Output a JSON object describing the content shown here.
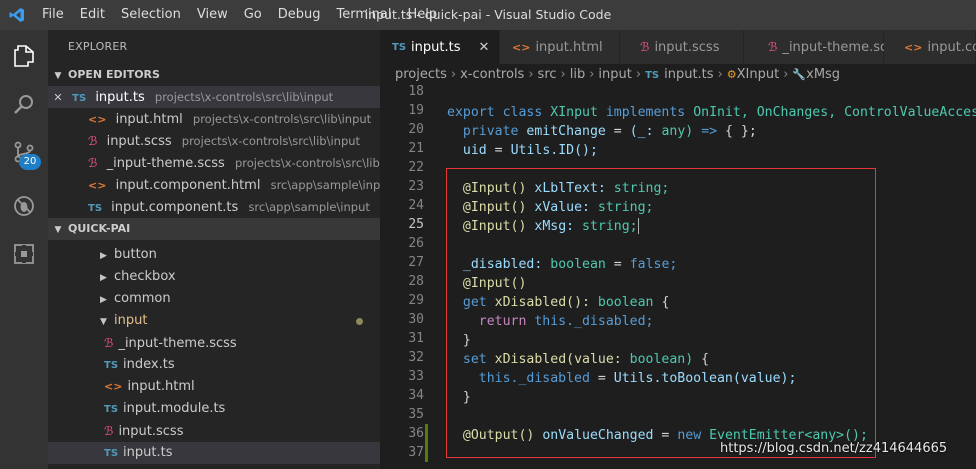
{
  "menu": [
    "File",
    "Edit",
    "Selection",
    "View",
    "Go",
    "Debug",
    "Terminal",
    "Help"
  ],
  "window_title": "input.ts - quick-pai - Visual Studio Code",
  "scm_badge": "20",
  "sidebar": {
    "title": "EXPLORER",
    "open_editors": {
      "header": "OPEN EDITORS",
      "items": [
        {
          "type": "TS",
          "name": "input.ts",
          "path": "projects\\x-controls\\src\\lib\\input",
          "close": "✕"
        },
        {
          "type": "html",
          "name": "input.html",
          "path": "projects\\x-controls\\src\\lib\\input"
        },
        {
          "type": "scss",
          "name": "input.scss",
          "path": "projects\\x-controls\\src\\lib\\input"
        },
        {
          "type": "scss",
          "name": "_input-theme.scss",
          "path": "projects\\x-controls\\src\\lib\\input"
        },
        {
          "type": "html",
          "name": "input.component.html",
          "path": "src\\app\\sample\\input"
        },
        {
          "type": "TS",
          "name": "input.component.ts",
          "path": "src\\app\\sample\\input"
        }
      ]
    },
    "project": {
      "header": "QUICK-PAI",
      "folders": [
        "button",
        "checkbox",
        "common",
        "input"
      ],
      "files": [
        {
          "type": "scss",
          "name": "_input-theme.scss"
        },
        {
          "type": "TS",
          "name": "index.ts"
        },
        {
          "type": "html",
          "name": "input.html"
        },
        {
          "type": "TS",
          "name": "input.module.ts"
        },
        {
          "type": "scss",
          "name": "input.scss"
        },
        {
          "type": "TS",
          "name": "input.ts"
        }
      ]
    }
  },
  "tabs": [
    {
      "type": "TS",
      "label": "input.ts",
      "active": true,
      "close": "✕"
    },
    {
      "type": "html",
      "label": "input.html"
    },
    {
      "type": "scss",
      "label": "input.scss"
    },
    {
      "type": "scss",
      "label": "_input-theme.scss"
    },
    {
      "type": "html",
      "label": "input.com"
    }
  ],
  "breadcrumb": [
    "projects",
    "x-controls",
    "src",
    "lib",
    "input",
    "input.ts",
    "XInput",
    "xMsg"
  ],
  "breadcrumb_ts": "TS",
  "line_numbers": [
    "18",
    "19",
    "20",
    "21",
    "22",
    "23",
    "24",
    "25",
    "26",
    "27",
    "28",
    "29",
    "30",
    "31",
    "32",
    "33",
    "34",
    "35",
    "36",
    "37"
  ],
  "code": {
    "l19": [
      "export",
      "class",
      "XInput",
      "implements",
      "OnInit,",
      "OnChanges,",
      "ControlValueAccessor"
    ],
    "l20": [
      "private",
      "emitChange",
      "=",
      "(_:",
      "any)",
      "=>",
      "{ };"
    ],
    "l21": [
      "uid",
      "=",
      "Utils.ID();"
    ],
    "l23": [
      "@Input()",
      "xLblText:",
      "string;"
    ],
    "l24": [
      "@Input()",
      "xValue:",
      "string;"
    ],
    "l25": [
      "@Input()",
      "xMsg:",
      "string;"
    ],
    "l27": [
      "_disabled:",
      "boolean",
      "=",
      "false;"
    ],
    "l28": [
      "@Input()"
    ],
    "l29": [
      "get",
      "xDisabled():",
      "boolean",
      "{"
    ],
    "l30": [
      "return",
      "this._disabled;"
    ],
    "l31": [
      "}"
    ],
    "l32": [
      "set",
      "xDisabled(value:",
      "boolean)",
      "{"
    ],
    "l33": [
      "this._disabled",
      "=",
      "Utils.toBoolean(value);"
    ],
    "l34": [
      "}"
    ],
    "l36": [
      "@Output()",
      "onValueChanged",
      "=",
      "new",
      "EventEmitter<any>();"
    ]
  },
  "watermark": "https://blog.csdn.net/zz414644665"
}
